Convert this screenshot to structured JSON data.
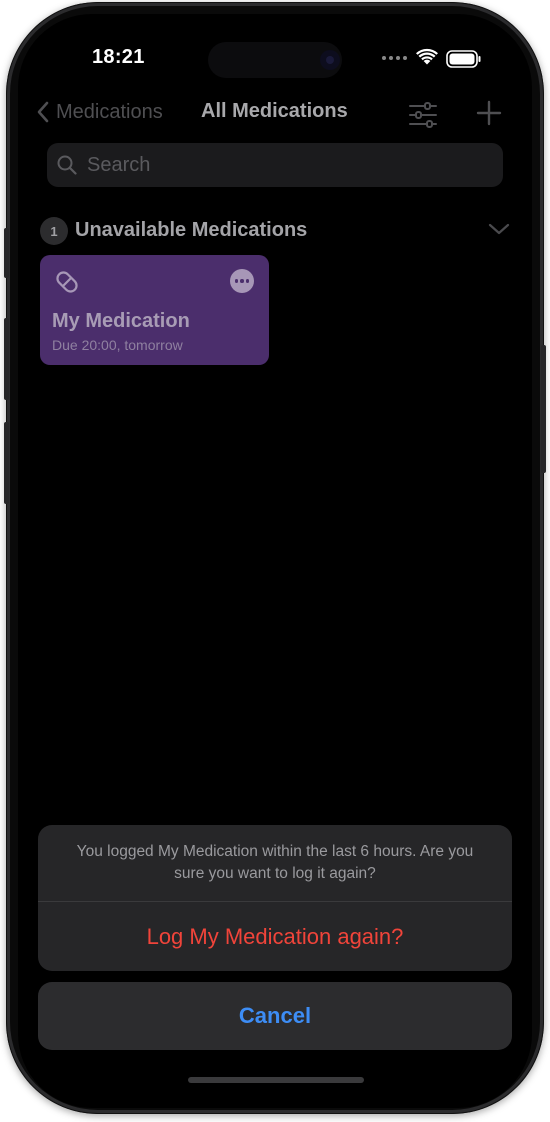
{
  "status_bar": {
    "time": "18:21"
  },
  "nav": {
    "back_label": "Medications",
    "title": "All Medications",
    "icons": {
      "back": "chevron-left-icon",
      "filter": "sliders-icon",
      "add": "plus-icon"
    }
  },
  "search": {
    "placeholder": "Search",
    "icon": "search-icon"
  },
  "section": {
    "count": "1",
    "title": "Unavailable Medications",
    "icon": "chevron-down-icon"
  },
  "medication": {
    "name": "My Medication",
    "due": "Due 20:00, tomorrow",
    "color": "#4b2e6c",
    "icons": {
      "type": "pill-icon",
      "more": "ellipsis-circle-icon"
    }
  },
  "action_sheet": {
    "message": "You logged My Medication within the last 6 hours. Are you sure you want to log it again?",
    "action_label": "Log My Medication again?",
    "cancel_label": "Cancel",
    "colors": {
      "destructive": "#f0443a",
      "cancel": "#3d8df5"
    }
  }
}
